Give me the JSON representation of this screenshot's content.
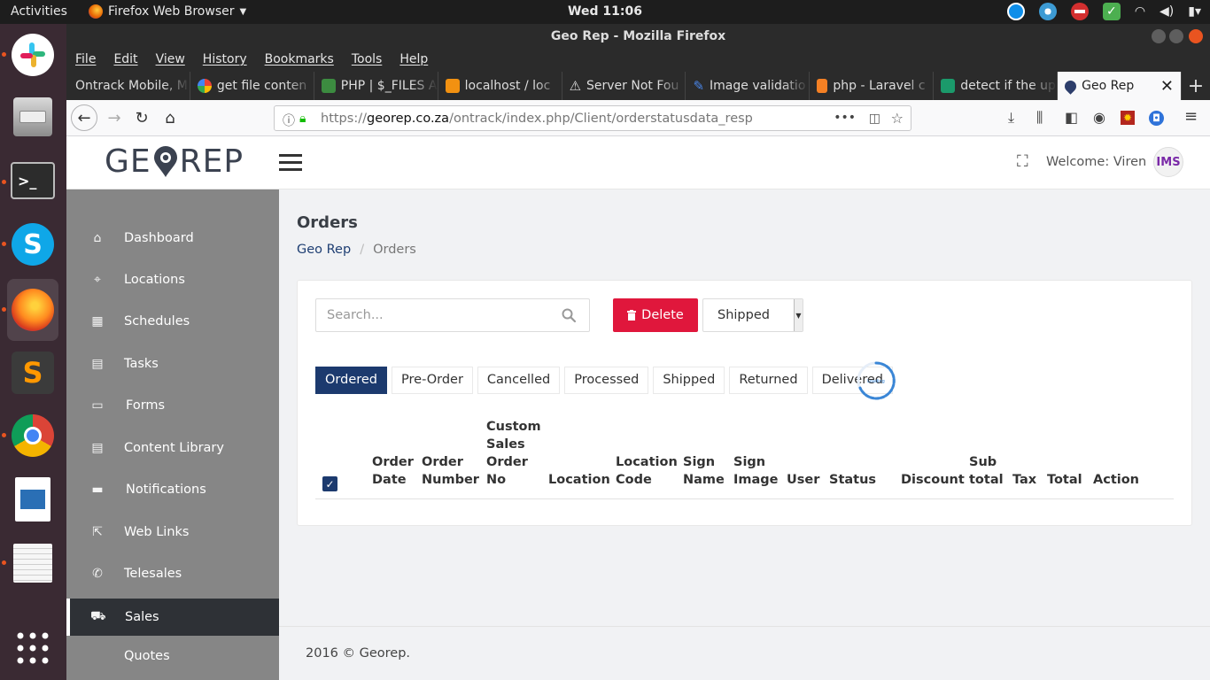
{
  "system": {
    "activities": "Activities",
    "app_menu": "Firefox Web Browser",
    "clock": "Wed 11:06"
  },
  "browser": {
    "window_title": "Geo Rep - Mozilla Firefox",
    "menu": [
      "File",
      "Edit",
      "View",
      "History",
      "Bookmarks",
      "Tools",
      "Help"
    ],
    "tabs": [
      {
        "label": "Ontrack Mobile, M",
        "favicon_color": "#2b2b2b"
      },
      {
        "label": "get file conten",
        "favicon_color": "#ffffff"
      },
      {
        "label": "PHP | $_FILES A",
        "favicon_color": "#3c8c40"
      },
      {
        "label": "localhost / loc",
        "favicon_color": "#f29111"
      },
      {
        "label": "Server Not Fou",
        "favicon_color": "#dddddd"
      },
      {
        "label": "Image validatio",
        "favicon_color": "#4a86e8"
      },
      {
        "label": "php - Laravel c",
        "favicon_color": "#f48024"
      },
      {
        "label": "detect if the up",
        "favicon_color": "#1b9a6b"
      },
      {
        "label": "Geo Rep",
        "favicon_color": "#2d3e6b"
      }
    ],
    "url_scheme": "https://",
    "url_host": "georep.co.za",
    "url_path": "/ontrack/index.php/Client/orderstatusdata_resp",
    "url_more": "•••"
  },
  "header": {
    "logo_left": "GE",
    "logo_right": "REP",
    "welcome": "Welcome: Viren",
    "avatar_text": "IMS"
  },
  "sidebar": {
    "items": [
      {
        "label": "Dashboard",
        "icon": "⌂"
      },
      {
        "label": "Locations",
        "icon": "⌖"
      },
      {
        "label": "Schedules",
        "icon": "▦"
      },
      {
        "label": "Tasks",
        "icon": "▤"
      },
      {
        "label": "Forms",
        "icon": "▭"
      },
      {
        "label": "Content Library",
        "icon": "▤"
      },
      {
        "label": "Notifications",
        "icon": "▬"
      },
      {
        "label": "Web Links",
        "icon": "⇱"
      },
      {
        "label": "Telesales",
        "icon": "✆"
      },
      {
        "label": "Sales",
        "icon": "⛟"
      }
    ],
    "sub_item": "Quotes"
  },
  "main": {
    "title": "Orders",
    "breadcrumb": {
      "home": "Geo Rep",
      "sep": "/",
      "current": "Orders"
    },
    "search_placeholder": "Search...",
    "delete_label": "Delete",
    "status_select": "Shipped",
    "tabs": [
      "Ordered",
      "Pre-Order",
      "Cancelled",
      "Processed",
      "Shipped",
      "Returned",
      "Delivered"
    ],
    "active_tab": "Ordered",
    "spinner_text": "Loading",
    "columns": [
      {
        "line1": "",
        "line2": "",
        "line3": "Order",
        "line4": "Date"
      },
      {
        "line1": "",
        "line2": "",
        "line3": "Order",
        "line4": "Number"
      },
      {
        "line1": "Custom",
        "line2": "Sales",
        "line3": "Order",
        "line4": "No"
      },
      {
        "line1": "",
        "line2": "",
        "line3": "",
        "line4": "Location"
      },
      {
        "line1": "",
        "line2": "",
        "line3": "Location",
        "line4": "Code"
      },
      {
        "line1": "",
        "line2": "",
        "line3": "Sign",
        "line4": "Name"
      },
      {
        "line1": "",
        "line2": "",
        "line3": "Sign",
        "line4": "Image"
      },
      {
        "line1": "",
        "line2": "",
        "line3": "",
        "line4": "User"
      },
      {
        "line1": "",
        "line2": "",
        "line3": "",
        "line4": "Status"
      },
      {
        "line1": "",
        "line2": "",
        "line3": "",
        "line4": "Discount"
      },
      {
        "line1": "",
        "line2": "",
        "line3": "Sub",
        "line4": "total"
      },
      {
        "line1": "",
        "line2": "",
        "line3": "",
        "line4": "Tax"
      },
      {
        "line1": "",
        "line2": "",
        "line3": "",
        "line4": "Total"
      },
      {
        "line1": "",
        "line2": "",
        "line3": "",
        "line4": "Action"
      }
    ]
  },
  "footer": {
    "text": "2016 © Georep."
  },
  "colors": {
    "brand_navy": "#1c3a6e",
    "danger": "#e0173c",
    "sidebar": "#868686",
    "sidebar_active": "#2e3136"
  }
}
